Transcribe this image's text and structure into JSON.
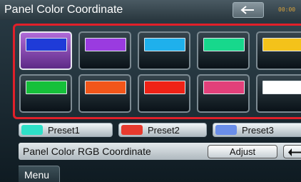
{
  "header": {
    "title": "Panel Color Coordinate",
    "clock": "00:00"
  },
  "palette": {
    "colors": [
      "#1f3bd8",
      "#9a3be0",
      "#1fb0ec",
      "#17d88c",
      "#f4c21a",
      "#16c03a",
      "#f2561a",
      "#ef2216",
      "#e2407a",
      "#ffffff"
    ],
    "selected_index": 0
  },
  "presets": [
    {
      "label": "Preset1",
      "color": "#2ee0c8"
    },
    {
      "label": "Preset2",
      "color": "#e83a2e"
    },
    {
      "label": "Preset3",
      "color": "#6a8ee8"
    }
  ],
  "rgb": {
    "label": "Panel Color RGB Coordinate",
    "adjust_label": "Adjust"
  },
  "bottom": {
    "menu_label": "Menu"
  }
}
